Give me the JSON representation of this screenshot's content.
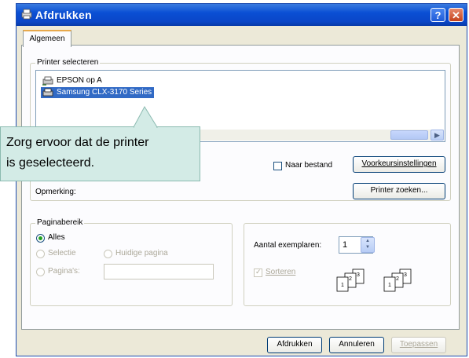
{
  "window": {
    "title": "Afdrukken",
    "help_label": "?",
    "close_label": "✕",
    "icon": "printer-icon"
  },
  "tabs": [
    {
      "label": "Algemeen",
      "selected": true
    }
  ],
  "printer_select": {
    "group_title": "Printer selecteren",
    "printers": [
      {
        "name": "EPSON op A",
        "selected": false,
        "icon": "printer-icon"
      },
      {
        "name": "Samsung CLX-3170 Series",
        "selected": true,
        "icon": "printer-icon"
      }
    ],
    "print_to_file_label": "Naar bestand",
    "print_to_file_checked": false,
    "preferences_button": "Voorkeursinstellingen",
    "find_printer_button": "Printer zoeken...",
    "comment_label": "Opmerking:"
  },
  "page_range": {
    "group_title": "Paginabereik",
    "options": {
      "all": "Alles",
      "selection": "Selectie",
      "current_page": "Huidige pagina",
      "pages": "Pagina's:"
    },
    "selected": "all",
    "pages_value": ""
  },
  "copies": {
    "label": "Aantal exemplaren:",
    "value": "1",
    "collate_label": "Sorteren",
    "collate_checked": true,
    "collate_enabled": false,
    "collate_pages": [
      "1",
      "2",
      "3"
    ]
  },
  "buttons": {
    "print": "Afdrukken",
    "cancel": "Annuleren",
    "apply": "Toepassen"
  },
  "callout": {
    "line1": "Zorg ervoor dat de printer",
    "line2": "is geselecteerd."
  },
  "colors": {
    "titlebar": "#0a4fd4",
    "selection": "#316ac5",
    "callout_bg": "#d3ebe6",
    "dialog_bg": "#ece9d8"
  }
}
